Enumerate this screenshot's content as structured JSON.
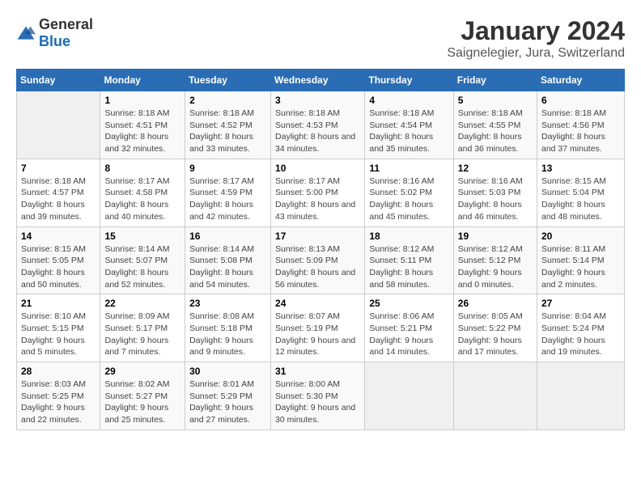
{
  "logo": {
    "text_general": "General",
    "text_blue": "Blue"
  },
  "title": "January 2024",
  "subtitle": "Saignelegier, Jura, Switzerland",
  "headers": [
    "Sunday",
    "Monday",
    "Tuesday",
    "Wednesday",
    "Thursday",
    "Friday",
    "Saturday"
  ],
  "weeks": [
    [
      {
        "day": "",
        "empty": true
      },
      {
        "day": "1",
        "sunrise": "8:18 AM",
        "sunset": "4:51 PM",
        "daylight": "8 hours and 32 minutes."
      },
      {
        "day": "2",
        "sunrise": "8:18 AM",
        "sunset": "4:52 PM",
        "daylight": "8 hours and 33 minutes."
      },
      {
        "day": "3",
        "sunrise": "8:18 AM",
        "sunset": "4:53 PM",
        "daylight": "8 hours and 34 minutes."
      },
      {
        "day": "4",
        "sunrise": "8:18 AM",
        "sunset": "4:54 PM",
        "daylight": "8 hours and 35 minutes."
      },
      {
        "day": "5",
        "sunrise": "8:18 AM",
        "sunset": "4:55 PM",
        "daylight": "8 hours and 36 minutes."
      },
      {
        "day": "6",
        "sunrise": "8:18 AM",
        "sunset": "4:56 PM",
        "daylight": "8 hours and 37 minutes."
      }
    ],
    [
      {
        "day": "7",
        "sunrise": "8:18 AM",
        "sunset": "4:57 PM",
        "daylight": "8 hours and 39 minutes."
      },
      {
        "day": "8",
        "sunrise": "8:17 AM",
        "sunset": "4:58 PM",
        "daylight": "8 hours and 40 minutes."
      },
      {
        "day": "9",
        "sunrise": "8:17 AM",
        "sunset": "4:59 PM",
        "daylight": "8 hours and 42 minutes."
      },
      {
        "day": "10",
        "sunrise": "8:17 AM",
        "sunset": "5:00 PM",
        "daylight": "8 hours and 43 minutes."
      },
      {
        "day": "11",
        "sunrise": "8:16 AM",
        "sunset": "5:02 PM",
        "daylight": "8 hours and 45 minutes."
      },
      {
        "day": "12",
        "sunrise": "8:16 AM",
        "sunset": "5:03 PM",
        "daylight": "8 hours and 46 minutes."
      },
      {
        "day": "13",
        "sunrise": "8:15 AM",
        "sunset": "5:04 PM",
        "daylight": "8 hours and 48 minutes."
      }
    ],
    [
      {
        "day": "14",
        "sunrise": "8:15 AM",
        "sunset": "5:05 PM",
        "daylight": "8 hours and 50 minutes."
      },
      {
        "day": "15",
        "sunrise": "8:14 AM",
        "sunset": "5:07 PM",
        "daylight": "8 hours and 52 minutes."
      },
      {
        "day": "16",
        "sunrise": "8:14 AM",
        "sunset": "5:08 PM",
        "daylight": "8 hours and 54 minutes."
      },
      {
        "day": "17",
        "sunrise": "8:13 AM",
        "sunset": "5:09 PM",
        "daylight": "8 hours and 56 minutes."
      },
      {
        "day": "18",
        "sunrise": "8:12 AM",
        "sunset": "5:11 PM",
        "daylight": "8 hours and 58 minutes."
      },
      {
        "day": "19",
        "sunrise": "8:12 AM",
        "sunset": "5:12 PM",
        "daylight": "9 hours and 0 minutes."
      },
      {
        "day": "20",
        "sunrise": "8:11 AM",
        "sunset": "5:14 PM",
        "daylight": "9 hours and 2 minutes."
      }
    ],
    [
      {
        "day": "21",
        "sunrise": "8:10 AM",
        "sunset": "5:15 PM",
        "daylight": "9 hours and 5 minutes."
      },
      {
        "day": "22",
        "sunrise": "8:09 AM",
        "sunset": "5:17 PM",
        "daylight": "9 hours and 7 minutes."
      },
      {
        "day": "23",
        "sunrise": "8:08 AM",
        "sunset": "5:18 PM",
        "daylight": "9 hours and 9 minutes."
      },
      {
        "day": "24",
        "sunrise": "8:07 AM",
        "sunset": "5:19 PM",
        "daylight": "9 hours and 12 minutes."
      },
      {
        "day": "25",
        "sunrise": "8:06 AM",
        "sunset": "5:21 PM",
        "daylight": "9 hours and 14 minutes."
      },
      {
        "day": "26",
        "sunrise": "8:05 AM",
        "sunset": "5:22 PM",
        "daylight": "9 hours and 17 minutes."
      },
      {
        "day": "27",
        "sunrise": "8:04 AM",
        "sunset": "5:24 PM",
        "daylight": "9 hours and 19 minutes."
      }
    ],
    [
      {
        "day": "28",
        "sunrise": "8:03 AM",
        "sunset": "5:25 PM",
        "daylight": "9 hours and 22 minutes."
      },
      {
        "day": "29",
        "sunrise": "8:02 AM",
        "sunset": "5:27 PM",
        "daylight": "9 hours and 25 minutes."
      },
      {
        "day": "30",
        "sunrise": "8:01 AM",
        "sunset": "5:29 PM",
        "daylight": "9 hours and 27 minutes."
      },
      {
        "day": "31",
        "sunrise": "8:00 AM",
        "sunset": "5:30 PM",
        "daylight": "9 hours and 30 minutes."
      },
      {
        "day": "",
        "empty": true
      },
      {
        "day": "",
        "empty": true
      },
      {
        "day": "",
        "empty": true
      }
    ]
  ],
  "labels": {
    "sunrise_prefix": "Sunrise: ",
    "sunset_prefix": "Sunset: ",
    "daylight_prefix": "Daylight: "
  }
}
